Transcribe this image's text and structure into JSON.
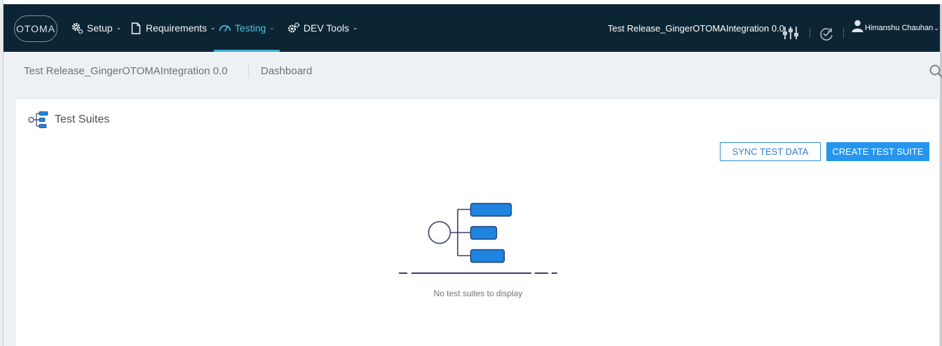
{
  "app": {
    "logo_text": "OTOMA",
    "accent_color": "#3fb1cc",
    "nav_background": "#0c2535",
    "primary_button_color": "#2596f0"
  },
  "nav": {
    "items": [
      {
        "label": "Setup",
        "icon": "gear-icon"
      },
      {
        "label": "Requirements",
        "icon": "document-icon"
      },
      {
        "label": "Testing",
        "icon": "gauge-icon",
        "active": true
      },
      {
        "label": "DEV Tools",
        "icon": "gears-icon"
      }
    ],
    "release_name": "Test Release_GingerOTOMAIntegration 0.0",
    "user_name": "Himanshu Chauhan"
  },
  "breadcrumb": {
    "release": "Test Release_GingerOTOMAIntegration 0.0",
    "page": "Dashboard"
  },
  "panel": {
    "title": "Test Suites",
    "sync_button": "SYNC TEST DATA",
    "create_button": "CREATE TEST SUITE",
    "empty_message": "No test suites to display"
  }
}
